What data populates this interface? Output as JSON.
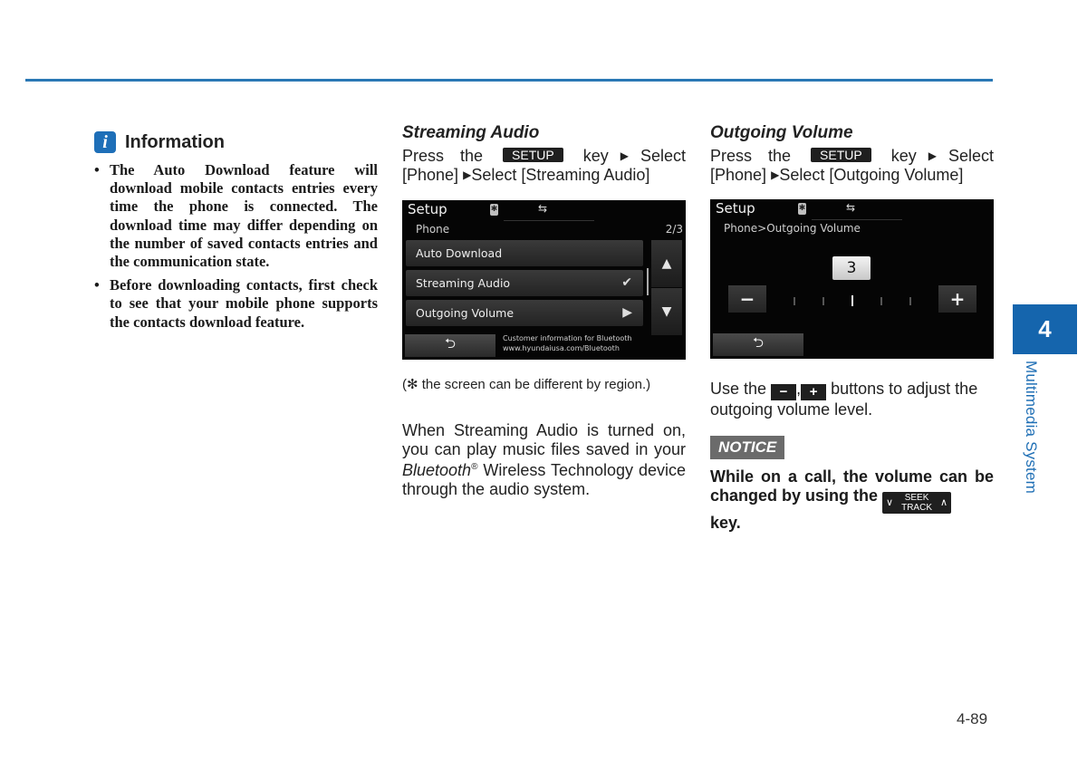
{
  "header": {
    "rule_color": "#2a78b5"
  },
  "information": {
    "icon": "info-icon",
    "icon_glyph": "i",
    "title": "Information",
    "bullets": [
      "The Auto Download feature will download mobile contacts entries every time the phone is connected. The download time may differ depending on the number of saved contacts entries and the communication state.",
      "Before downloading contacts, first check to see that your mobile phone supports the contacts download feature."
    ]
  },
  "streaming_audio": {
    "title": "Streaming Audio",
    "instruction": {
      "press": "Press the",
      "key": "SETUP",
      "key_select": "key",
      "select1": "Select",
      "phone": "[Phone]",
      "select2": "Select [Streaming Audio]"
    },
    "screen": {
      "title": "Setup",
      "bt_glyph": "✱",
      "usb_glyph": "⇆",
      "subtitle": "Phone",
      "page": "2/3",
      "items": [
        {
          "label": "Auto Download",
          "indicator": ""
        },
        {
          "label": "Streaming Audio",
          "indicator": "✔"
        },
        {
          "label": "Outgoing Volume",
          "indicator": "▶"
        }
      ],
      "scroll_up": "▲",
      "scroll_down": "▼",
      "back_glyph": "⮌",
      "customer_info_line1": "Customer information for Bluetooth",
      "customer_info_line2": "www.hyundaiusa.com/Bluetooth"
    },
    "caption": "(✻ the screen can be different by region.)",
    "description": {
      "part1": "When Streaming Audio is turned on, you can play music files saved in your ",
      "bluetooth": "Bluetooth",
      "registered": "®",
      "part2": " Wireless Technology device through the audio system."
    }
  },
  "outgoing_volume": {
    "title": "Outgoing Volume",
    "instruction": {
      "press": "Press the",
      "key": "SETUP",
      "key_select": "key",
      "select1": "Select",
      "phone": "[Phone]",
      "select2": "Select [Outgoing Volume]"
    },
    "screen": {
      "title": "Setup",
      "bt_glyph": "✱",
      "usb_glyph": "⇆",
      "breadcrumb": "Phone>Outgoing Volume",
      "volume_value": "3",
      "volume_level": 3,
      "volume_steps": 5,
      "minus": "−",
      "plus": "+",
      "back_glyph": "⮌"
    },
    "usage": {
      "part1": "Use the",
      "minus": "−",
      "comma": ",",
      "plus": "+",
      "part2": "buttons to adjust the outgoing volume level."
    },
    "notice": {
      "badge": "NOTICE",
      "text1": "While on a call, the volume can be changed by using the",
      "key_line1": "SEEK",
      "key_line2": "TRACK",
      "key_left": "∨",
      "key_right": "∧",
      "text2": "key."
    }
  },
  "side_tab": {
    "chapter": "4",
    "label": "Multimedia System",
    "color": "#1565ad"
  },
  "footer": {
    "page_number": "4-89"
  }
}
